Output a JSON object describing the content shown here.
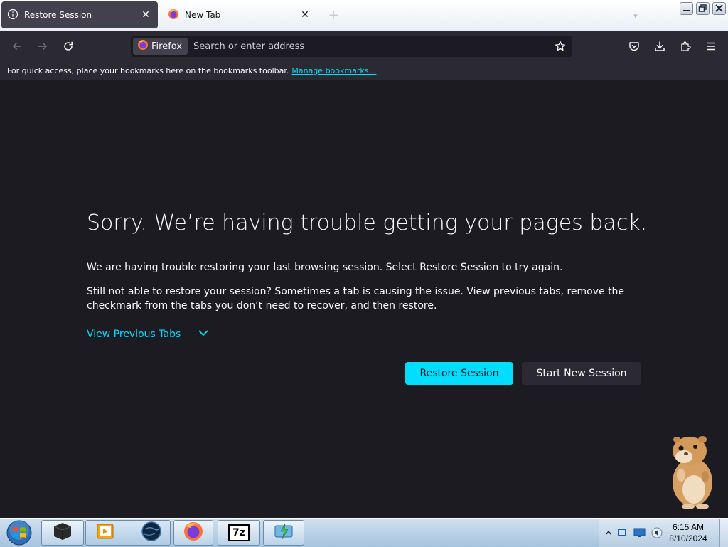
{
  "tabs": [
    {
      "label": "Restore Session",
      "icon": "info-icon",
      "active": true
    },
    {
      "label": "New Tab",
      "icon": "firefox-icon",
      "active": false
    }
  ],
  "toolbar": {
    "identity_label": "Firefox",
    "url_placeholder": "Search or enter address"
  },
  "bookmarks_bar": {
    "text": "For quick access, place your bookmarks here on the bookmarks toolbar.",
    "link": "Manage bookmarks…"
  },
  "page": {
    "title": "Sorry. We’re having trouble getting your pages back.",
    "para1": "We are having trouble restoring your last browsing session. Select Restore Session to try again.",
    "para2": "Still not able to restore your session? Sometimes a tab is causing the issue. View previous tabs, remove the checkmark from the tabs you don’t need to recover, and then restore.",
    "view_tabs": "View Previous Tabs",
    "restore_button": "Restore Session",
    "new_session_button": "Start New Session"
  },
  "taskbar": {
    "items": [
      "terminal-app-icon",
      "media-player-icon",
      "globe-app-icon",
      "firefox-icon",
      "7zip-icon",
      "app-launcher-icon"
    ],
    "label_7zip": "7z",
    "time": "6:15 AM",
    "date": "8/10/2024"
  },
  "colors": {
    "accent": "#00ddff",
    "page_bg": "#1c1b22",
    "toolbar_bg": "#2b2a33",
    "text": "#fbfbfe"
  }
}
